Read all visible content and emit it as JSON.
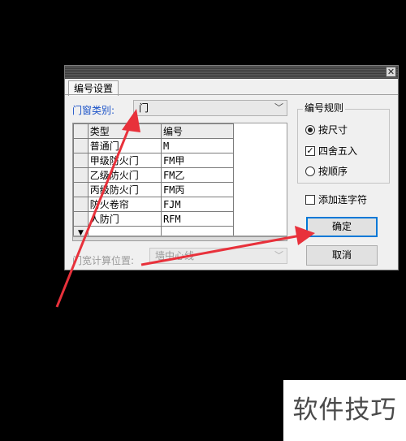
{
  "dialog": {
    "close": "✕",
    "tab": "编号设置",
    "category_label": "门窗类别:",
    "category_value": "门",
    "table": {
      "headers": [
        "类型",
        "编号"
      ],
      "rows": [
        {
          "type": "普通门",
          "code": "M"
        },
        {
          "type": "甲级防火门",
          "code": "FM甲"
        },
        {
          "type": "乙级防火门",
          "code": "FM乙"
        },
        {
          "type": "丙级防火门",
          "code": "FM丙"
        },
        {
          "type": "防火卷帘",
          "code": "FJM"
        },
        {
          "type": "人防门",
          "code": "RFM"
        }
      ],
      "new_row_marker": "▼"
    },
    "position_label": "门宽计算位置:",
    "position_value": "墙中心线",
    "rules": {
      "title": "编号规则",
      "by_size": "按尺寸",
      "round": "四舍五入",
      "by_order": "按顺序"
    },
    "add_connector": "添加连字符",
    "ok": "确定",
    "cancel": "取消"
  },
  "watermark": "软件技巧",
  "colors": {
    "arrow": "#e8313b",
    "label_blue": "#1a52c8",
    "focus": "#0078d7"
  }
}
